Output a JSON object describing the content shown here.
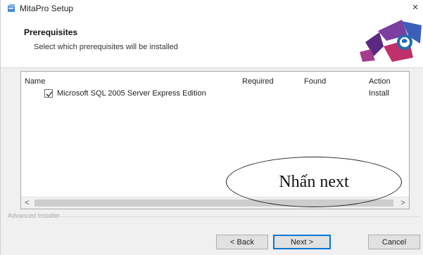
{
  "window": {
    "title": "MitaPro Setup",
    "close_glyph": "×",
    "icon": "installer-app-icon"
  },
  "header": {
    "title": "Prerequisites",
    "subtitle": "Select which prerequisites will be installed",
    "logo_icon": "installer-logo-graphic"
  },
  "table": {
    "columns": [
      "Name",
      "Required",
      "Found",
      "Action"
    ],
    "rows": [
      {
        "checked": true,
        "name": "Microsoft SQL 2005 Server Express Edition",
        "required": "",
        "found": "",
        "action": "Install"
      }
    ],
    "scroll_left_glyph": "<",
    "scroll_right_glyph": ">"
  },
  "footer": {
    "brand_label": "Advanced Installer"
  },
  "buttons": {
    "back": "< Back",
    "next": "Next >",
    "cancel": "Cancel"
  },
  "annotation": {
    "text": "Nhấn next"
  },
  "colors": {
    "accent": "#0078d7",
    "logo_primary": "#5a2a82",
    "logo_secondary": "#c0306a",
    "logo_tertiary": "#1f6fb2"
  }
}
